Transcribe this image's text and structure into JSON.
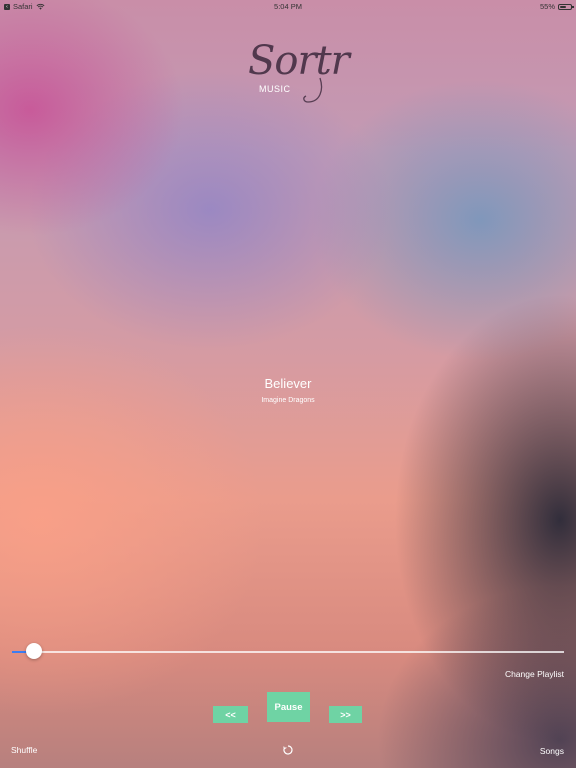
{
  "status_bar": {
    "back_app": "Safari",
    "time": "5:04 PM",
    "battery_percent": "55%",
    "battery_level": 0.55
  },
  "logo": {
    "script": "Sortr",
    "subtitle": "MUSIC"
  },
  "track": {
    "title": "Believer",
    "artist": "Imagine Dragons"
  },
  "player": {
    "progress": 0.04,
    "change_playlist_label": "Change Playlist",
    "prev_label": "<<",
    "pause_label": "Pause",
    "next_label": ">>",
    "shuffle_label": "Shuffle",
    "songs_label": "Songs"
  },
  "colors": {
    "button_accent": "#6fd3a4",
    "slider_fill": "#3b7df2"
  },
  "icons": [
    "back-to-app-icon",
    "wifi-icon",
    "battery-icon",
    "spinner-icon"
  ]
}
